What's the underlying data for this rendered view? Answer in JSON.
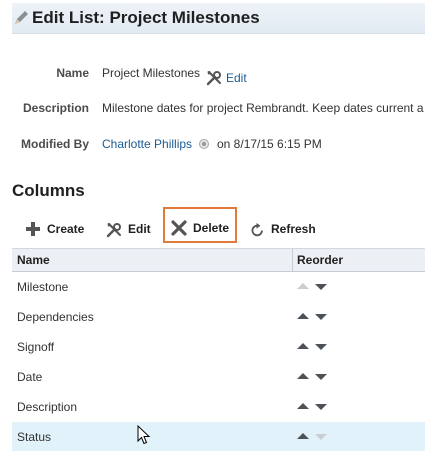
{
  "header": {
    "title": "Edit List: Project Milestones"
  },
  "details": {
    "name_label": "Name",
    "name_value": "Project Milestones",
    "edit_link": "Edit",
    "description_label": "Description",
    "description_value": "Milestone dates for project Rembrandt. Keep dates current a",
    "modified_by_label": "Modified By",
    "modified_by_user": "Charlotte Phillips",
    "modified_on": "on 8/17/15 6:15 PM"
  },
  "columns_section": {
    "title": "Columns",
    "toolbar": {
      "create_label": "Create",
      "edit_label": "Edit",
      "delete_label": "Delete",
      "refresh_label": "Refresh"
    },
    "table": {
      "headers": [
        "Name",
        "Reorder"
      ],
      "rows": [
        {
          "name": "Milestone",
          "up_enabled": false,
          "down_enabled": true
        },
        {
          "name": "Dependencies",
          "up_enabled": true,
          "down_enabled": true
        },
        {
          "name": "Signoff",
          "up_enabled": true,
          "down_enabled": true
        },
        {
          "name": "Date",
          "up_enabled": true,
          "down_enabled": true
        },
        {
          "name": "Description",
          "up_enabled": true,
          "down_enabled": true
        },
        {
          "name": "Status",
          "up_enabled": true,
          "down_enabled": false,
          "selected": true
        }
      ]
    }
  },
  "colors": {
    "link": "#1b5b93",
    "highlight_border": "#e07b39",
    "selected_row": "#e2f2fa",
    "header_bg": "#e2eaf2"
  },
  "icons": {
    "title": "pencil-icon",
    "edit_link": "wrench-screwdriver-icon",
    "presence": "presence-status-icon",
    "create": "plus-icon",
    "edit": "wrench-screwdriver-icon",
    "delete": "x-icon",
    "refresh": "refresh-icon",
    "reorder_up": "triangle-up-icon",
    "reorder_down": "triangle-down-icon"
  }
}
